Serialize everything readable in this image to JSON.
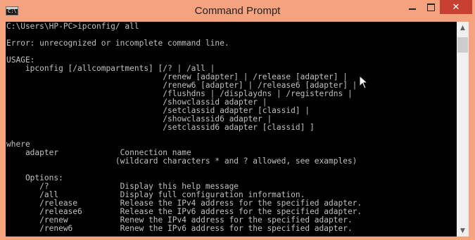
{
  "window": {
    "title": "Command Prompt",
    "icon_glyph": "C:\\",
    "controls": {
      "minimize": "minimize-icon",
      "maximize": "maximize-icon",
      "close": "✕"
    }
  },
  "console": {
    "lines": [
      "C:\\Users\\HP-PC>ipconfig/ all",
      "",
      "Error: unrecognized or incomplete command line.",
      "",
      "USAGE:",
      "    ipconfig [/allcompartments] [/? | /all |",
      "                                 /renew [adapter] | /release [adapter] |",
      "                                 /renew6 [adapter] | /release6 [adapter] |",
      "                                 /flushdns | /displaydns | /registerdns |",
      "                                 /showclassid adapter |",
      "                                 /setclassid adapter [classid] |",
      "                                 /showclassid6 adapter |",
      "                                 /setclassid6 adapter [classid] ]",
      "",
      "where",
      "    adapter             Connection name",
      "                       (wildcard characters * and ? allowed, see examples)",
      "",
      "    Options:",
      "       /?               Display this help message",
      "       /all             Display full configuration information.",
      "       /release         Release the IPv4 address for the specified adapter.",
      "       /release6        Release the IPv6 address for the specified adapter.",
      "       /renew           Renew the IPv4 address for the specified adapter.",
      "       /renew6          Renew the IPv6 address for the specified adapter."
    ]
  },
  "scrollbar": {
    "up_arrow": "▲",
    "down_arrow": "▼",
    "position_fraction": 0.0
  },
  "colors": {
    "titlebar": "#f4a37e",
    "console_bg": "#000000",
    "console_text": "#c0c0c0",
    "close_button": "#c84031"
  }
}
